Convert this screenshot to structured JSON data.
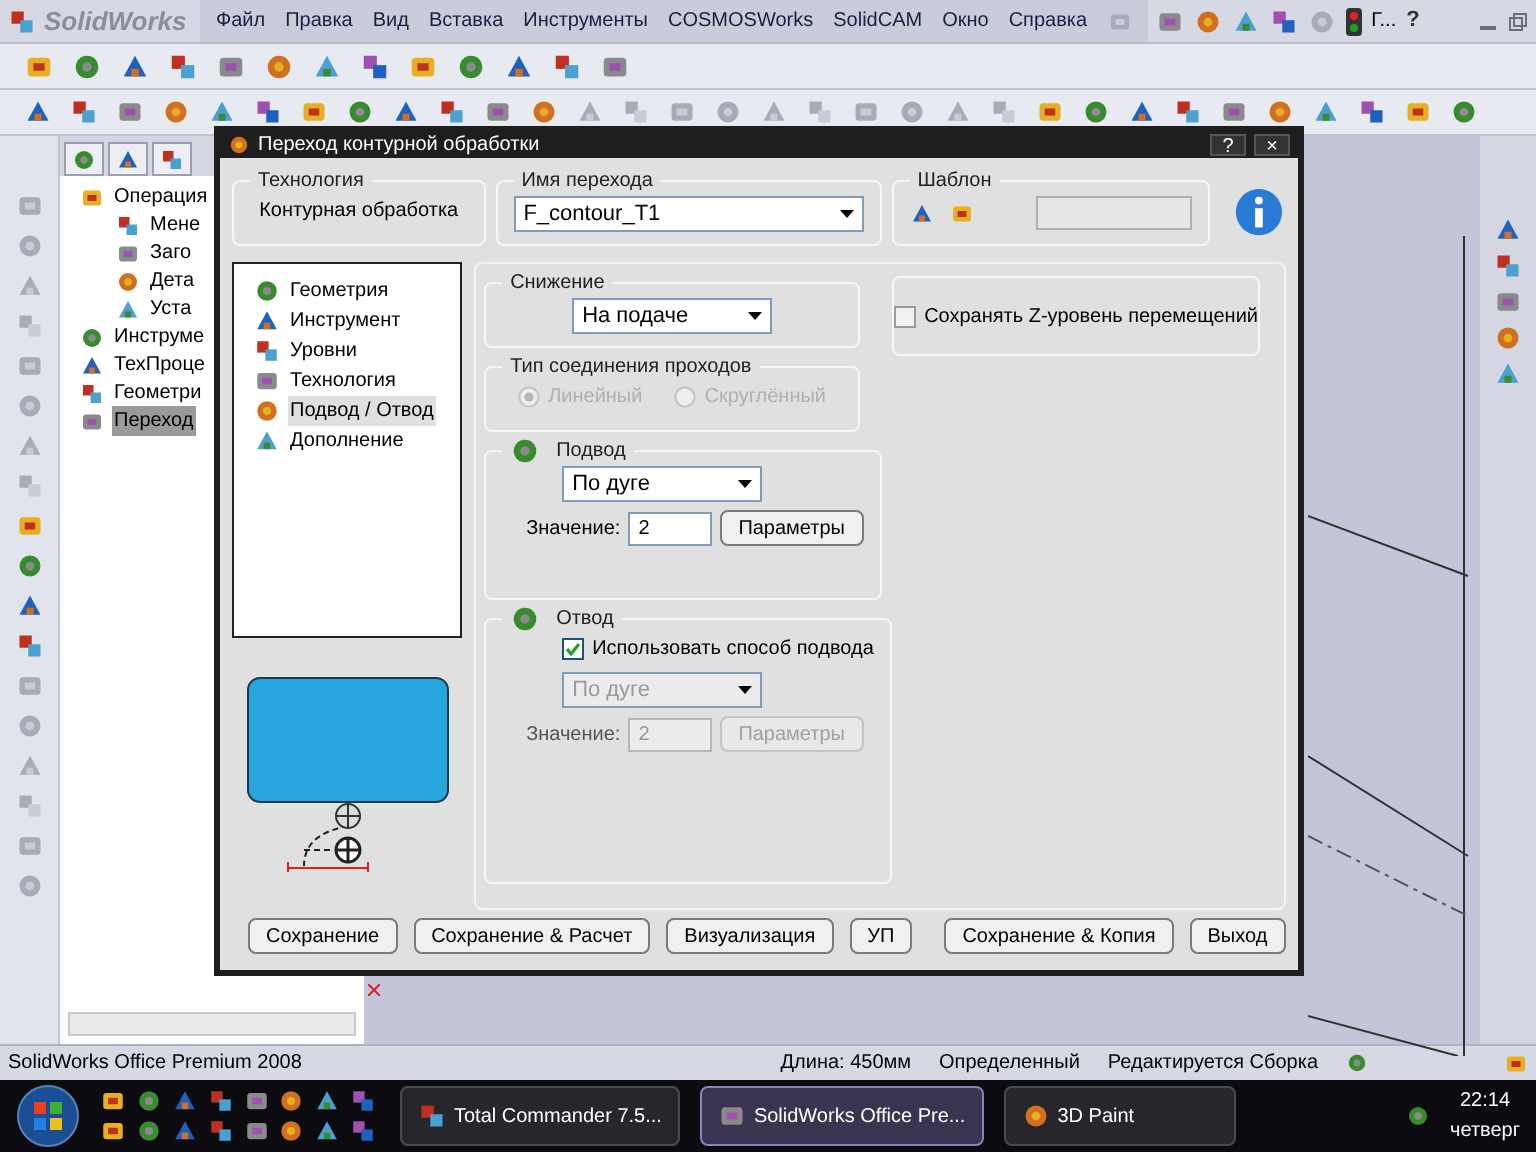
{
  "app": {
    "logo": "SolidWorks",
    "menu": [
      "Файл",
      "Правка",
      "Вид",
      "Вставка",
      "Инструменты",
      "COSMOSWorks",
      "SolidCAM",
      "Окно",
      "Справка"
    ],
    "user_label": "Г...",
    "help": "?"
  },
  "feature_tree": {
    "items": [
      {
        "label": "Операция",
        "selected": false,
        "children": [
          {
            "label": "Мене",
            "selected": false
          },
          {
            "label": "Заго",
            "selected": false
          },
          {
            "label": "Дета",
            "selected": false
          },
          {
            "label": "Уста",
            "selected": false
          }
        ]
      },
      {
        "label": "Инструме",
        "selected": false
      },
      {
        "label": "ТехПроце",
        "selected": false
      },
      {
        "label": "Геометри",
        "selected": false
      },
      {
        "label": "Переход",
        "selected": true
      }
    ]
  },
  "dialog": {
    "title": "Переход контурной обработки",
    "title_buttons": [
      "?",
      "×"
    ],
    "technology": {
      "label": "Технология",
      "value": "Контурная обработка"
    },
    "operation_name": {
      "label": "Имя перехода",
      "value": "F_contour_T1"
    },
    "template": {
      "label": "Шаблон"
    },
    "sections": [
      {
        "label": "Геометрия",
        "selected": false
      },
      {
        "label": "Инструмент",
        "selected": false
      },
      {
        "label": "Уровни",
        "selected": false
      },
      {
        "label": "Технология",
        "selected": false
      },
      {
        "label": "Подвод / Отвод",
        "selected": true
      },
      {
        "label": "Дополнение",
        "selected": false
      }
    ],
    "lowering": {
      "label": "Снижение",
      "value": "На подаче"
    },
    "pass_link": {
      "label": "Тип соединения проходов",
      "disabled": true,
      "options": [
        {
          "label": "Линейный",
          "selected": true
        },
        {
          "label": "Скруглённый",
          "selected": false
        }
      ]
    },
    "lead_in": {
      "label": "Подвод",
      "method": "По дуге",
      "value_label": "Значение:",
      "value": "2",
      "button": "Параметры",
      "disabled": false
    },
    "lead_out": {
      "label": "Отвод",
      "use_lead_in": {
        "label": "Использовать способ подвода",
        "checked": true
      },
      "method": "По дуге",
      "value_label": "Значение:",
      "value": "2",
      "button": "Параметры",
      "disabled": true
    },
    "keep_z": {
      "label": "Сохранять Z-уровень перемещений",
      "checked": false
    },
    "buttons_left": [
      "Сохранение",
      "Сохранение & Расчет",
      "Визуализация",
      "УП"
    ],
    "buttons_right": [
      "Сохранение & Копия",
      "Выход"
    ]
  },
  "status_bar": {
    "product": "SolidWorks Office Premium 2008",
    "length": "Длина: 450мм",
    "state": "Определенный",
    "mode": "Редактируется Сборка"
  },
  "taskbar": {
    "tasks": [
      {
        "label": "Total Commander 7.5...",
        "selected": false
      },
      {
        "label": "SolidWorks Office Pre...",
        "selected": true
      },
      {
        "label": "3D Paint",
        "selected": false
      }
    ],
    "time": "22:14",
    "day": "четверг"
  }
}
